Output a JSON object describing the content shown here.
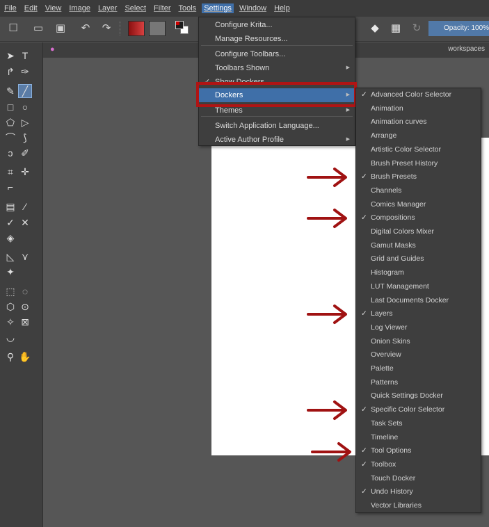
{
  "menubar": {
    "items": [
      "File",
      "Edit",
      "View",
      "Image",
      "Layer",
      "Select",
      "Filter",
      "Tools",
      "Settings",
      "Window",
      "Help"
    ],
    "active_index": 8
  },
  "toolbar": {
    "opacity_label": "Opacity: 100%"
  },
  "tabrow": {
    "workspaces_label": "workspaces"
  },
  "settings_menu": {
    "items": [
      {
        "label": "Configure Krita...",
        "submenu": false,
        "checked": false
      },
      {
        "label": "Manage Resources...",
        "submenu": false,
        "checked": false
      },
      {
        "label": "Configure Toolbars...",
        "submenu": false,
        "checked": false
      },
      {
        "label": "Toolbars Shown",
        "submenu": true,
        "checked": false
      },
      {
        "label": "Show Dockers",
        "submenu": false,
        "checked": true
      },
      {
        "label": "Dockers",
        "submenu": true,
        "checked": false,
        "highlighted": true
      },
      {
        "label": "Themes",
        "submenu": true,
        "checked": false
      },
      {
        "label": "Switch Application Language...",
        "submenu": false,
        "checked": false
      },
      {
        "label": "Active Author Profile",
        "submenu": true,
        "checked": false
      }
    ]
  },
  "dockers_menu": {
    "items": [
      {
        "label": "Advanced Color Selector",
        "checked": true
      },
      {
        "label": "Animation",
        "checked": false
      },
      {
        "label": "Animation curves",
        "checked": false
      },
      {
        "label": "Arrange",
        "checked": false
      },
      {
        "label": "Artistic Color Selector",
        "checked": false
      },
      {
        "label": "Brush Preset History",
        "checked": false
      },
      {
        "label": "Brush Presets",
        "checked": true
      },
      {
        "label": "Channels",
        "checked": false
      },
      {
        "label": "Comics Manager",
        "checked": false
      },
      {
        "label": "Compositions",
        "checked": true
      },
      {
        "label": "Digital Colors Mixer",
        "checked": false
      },
      {
        "label": "Gamut Masks",
        "checked": false
      },
      {
        "label": "Grid and Guides",
        "checked": false
      },
      {
        "label": "Histogram",
        "checked": false
      },
      {
        "label": "LUT Management",
        "checked": false
      },
      {
        "label": "Last Documents Docker",
        "checked": false
      },
      {
        "label": "Layers",
        "checked": true
      },
      {
        "label": "Log Viewer",
        "checked": false
      },
      {
        "label": "Onion Skins",
        "checked": false
      },
      {
        "label": "Overview",
        "checked": false
      },
      {
        "label": "Palette",
        "checked": false
      },
      {
        "label": "Patterns",
        "checked": false
      },
      {
        "label": "Quick Settings Docker",
        "checked": false
      },
      {
        "label": "Specific Color Selector",
        "checked": true
      },
      {
        "label": "Task Sets",
        "checked": false
      },
      {
        "label": "Timeline",
        "checked": false
      },
      {
        "label": "Tool Options",
        "checked": true
      },
      {
        "label": "Toolbox",
        "checked": true
      },
      {
        "label": "Touch Docker",
        "checked": false
      },
      {
        "label": "Undo History",
        "checked": true
      },
      {
        "label": "Vector Libraries",
        "checked": false
      }
    ]
  },
  "check_glyph": "✓",
  "colors": {
    "highlight": "#3f6fa8",
    "annotation_red": "#a01212",
    "menu_bg": "#3e3e3e",
    "canvas_bg": "#565656"
  }
}
